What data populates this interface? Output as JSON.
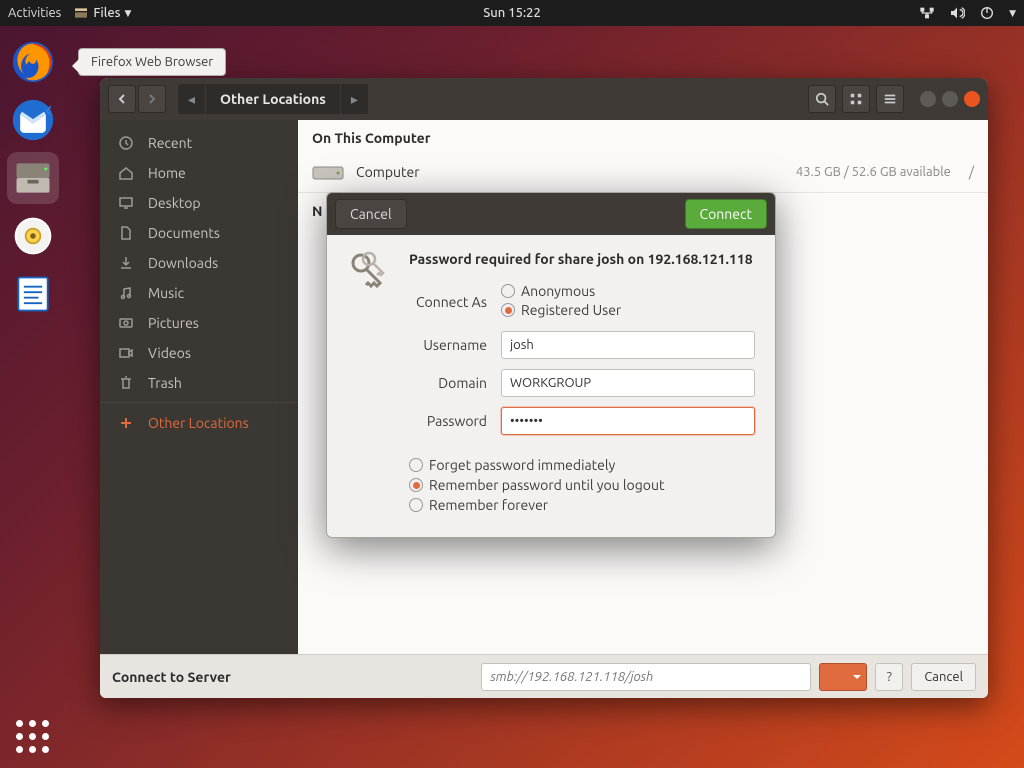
{
  "topbar": {
    "activities": "Activities",
    "app": "Files",
    "clock": "Sun 15:22"
  },
  "tooltip": "Firefox Web Browser",
  "fileswin": {
    "path": "Other Locations",
    "section_computer": "On This Computer",
    "drive": {
      "name": "Computer",
      "info": "43.5 GB / 52.6 GB available",
      "slash": "/"
    },
    "section_network": "N",
    "sidebar": [
      "Recent",
      "Home",
      "Desktop",
      "Documents",
      "Downloads",
      "Music",
      "Pictures",
      "Videos",
      "Trash"
    ],
    "sidebar_other": "Other Locations",
    "footer": {
      "label": "Connect to Server",
      "placeholder": "smb://192.168.121.118/josh",
      "question": "?",
      "cancel": "Cancel"
    }
  },
  "dialog": {
    "cancel": "Cancel",
    "connect": "Connect",
    "title": "Password required for share josh on 192.168.121.118",
    "connect_as": "Connect As",
    "anon": "Anonymous",
    "reg": "Registered User",
    "username_lbl": "Username",
    "username": "josh",
    "domain_lbl": "Domain",
    "domain": "WORKGROUP",
    "password_lbl": "Password",
    "password": "•••••••",
    "forget": "Forget password immediately",
    "remember_logout": "Remember password until you logout",
    "remember_forever": "Remember forever"
  }
}
